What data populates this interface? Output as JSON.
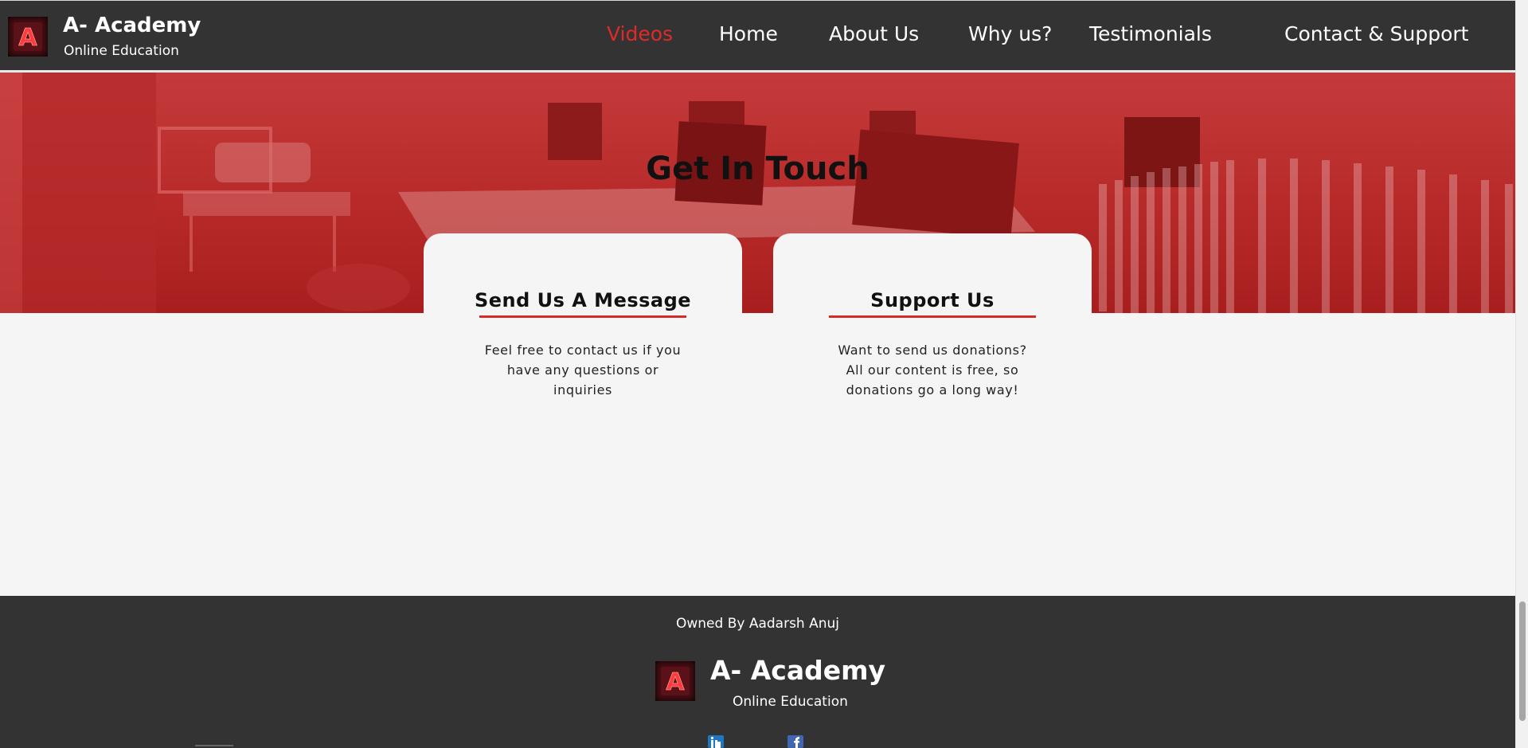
{
  "brand": {
    "title": "A- Academy",
    "subtitle": "Online Education",
    "logo_letter": "A",
    "logo_icon": "academy-logo-icon"
  },
  "nav": {
    "items": [
      {
        "label": "Videos",
        "active": true
      },
      {
        "label": "Home",
        "active": false
      },
      {
        "label": "About Us",
        "active": false
      },
      {
        "label": "Why us?",
        "active": false
      },
      {
        "label": "Testimonials",
        "active": false
      },
      {
        "label": "Contact & Support",
        "active": false
      }
    ]
  },
  "hero": {
    "title": "Get In Touch"
  },
  "cards": [
    {
      "title": "Send Us A Message",
      "body": "Feel free to contact us if you have any questions or inquiries"
    },
    {
      "title": "Support Us",
      "body": "Want to send us donations? All our content is free, so donations go a long way!"
    }
  ],
  "footer": {
    "owned": "Owned By Aadarsh Anuj",
    "title": "A- Academy",
    "subtitle": "Online Education",
    "social_icons": [
      "linkedin-icon",
      "facebook-icon"
    ]
  },
  "colors": {
    "header_bg": "#333333",
    "accent_red": "#d42b2b",
    "active_nav": "#e02a2a",
    "hero_red": "#c43a3a",
    "page_bg": "#f5f5f5"
  }
}
